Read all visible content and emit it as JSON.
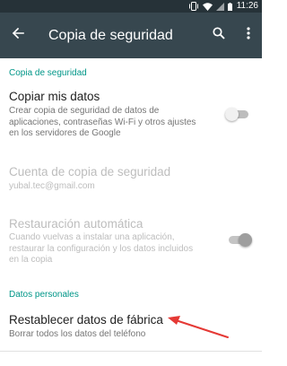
{
  "status_bar": {
    "time": "11:26",
    "icons": [
      "vibrate-icon",
      "wifi-icon",
      "signal-icon",
      "battery-icon"
    ]
  },
  "app_bar": {
    "title": "Copia de seguridad",
    "icons": [
      "back-arrow-icon",
      "search-icon",
      "more-vert-icon"
    ]
  },
  "sections": [
    {
      "header": "Copia de seguridad"
    },
    {
      "header": "Datos personales"
    }
  ],
  "prefs": {
    "backup": {
      "title": "Copiar mis datos",
      "summary_lines": [
        "Crear copia de seguridad de datos de",
        "aplicaciones, contraseñas Wi-Fi y otros ajustes",
        "en los servidores de Google"
      ],
      "toggle_on": false
    },
    "account": {
      "title": "Cuenta de copia de seguridad",
      "summary": "yubal.tec@gmail.com"
    },
    "restore": {
      "title": "Restauración automática",
      "summary_lines": [
        "Cuando vuelvas a instalar una aplicación,",
        "restaurar la configuración y los datos incluidos",
        "en la copia"
      ],
      "toggle_on": true
    },
    "factory_reset": {
      "title": "Restablecer datos de fábrica",
      "summary": "Borrar todos los datos del teléfono"
    }
  },
  "colors": {
    "status_bar": "#263238",
    "app_bar": "#37474f",
    "accent": "#009688",
    "annotation_arrow": "#e53935"
  }
}
